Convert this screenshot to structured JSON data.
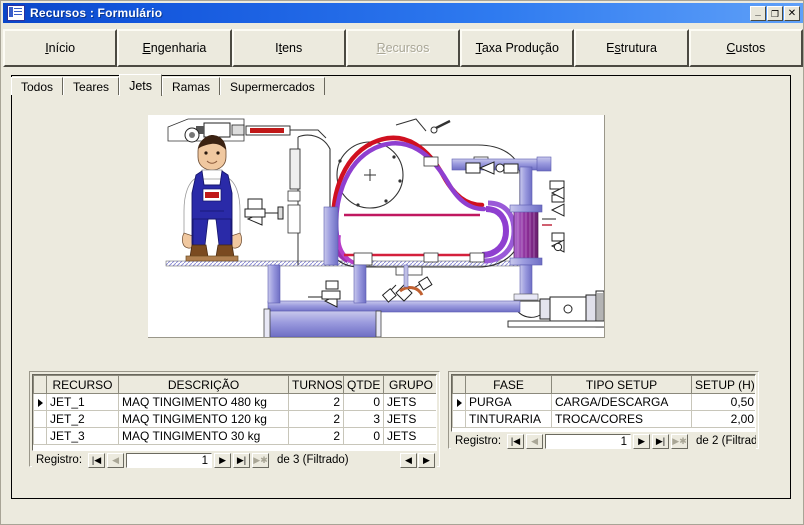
{
  "window": {
    "title": "Recursos : Formulário",
    "icon": "access-form-icon",
    "minimize_label": "_",
    "maximize_label": "❐",
    "close_label": "✕"
  },
  "menubar": {
    "items": [
      {
        "label": "Início",
        "accel": "I",
        "disabled": false,
        "name": "menu-inicio"
      },
      {
        "label": "Engenharia",
        "accel": "E",
        "disabled": false,
        "name": "menu-engenharia"
      },
      {
        "label": "Itens",
        "accel": "t",
        "disabled": false,
        "name": "menu-itens"
      },
      {
        "label": "Recursos",
        "accel": "R",
        "disabled": true,
        "name": "menu-recursos"
      },
      {
        "label": "Taxa Produção",
        "accel": "T",
        "disabled": false,
        "name": "menu-taxa-producao"
      },
      {
        "label": "Estrutura",
        "accel": "s",
        "disabled": false,
        "name": "menu-estrutura"
      },
      {
        "label": "Custos",
        "accel": "C",
        "disabled": false,
        "name": "menu-custos"
      }
    ]
  },
  "tabs": {
    "active": "Jets",
    "items": [
      {
        "label": "Todos",
        "active": false
      },
      {
        "label": "Teares",
        "active": false
      },
      {
        "label": "Jets",
        "active": true
      },
      {
        "label": "Ramas",
        "active": false
      },
      {
        "label": "Supermercados",
        "active": false
      }
    ]
  },
  "picture": {
    "name": "jet-dyeing-machine-diagram",
    "alt": "Diagrama de máquina de tingimento jet com operador, tubulação, trocador de calor e bomba"
  },
  "resources_grid": {
    "columns": [
      "RECURSO",
      "DESCRIÇÃO",
      "TURNOS",
      "QTDE",
      "GRUPO"
    ],
    "rows": [
      {
        "selected": true,
        "RECURSO": "JET_1",
        "DESCRIÇÃO": "MAQ TINGIMENTO 480 kg",
        "TURNOS": "2",
        "QTDE": "0",
        "GRUPO": "JETS"
      },
      {
        "selected": false,
        "RECURSO": "JET_2",
        "DESCRIÇÃO": "MAQ TINGIMENTO 120 kg",
        "TURNOS": "2",
        "QTDE": "3",
        "GRUPO": "JETS"
      },
      {
        "selected": false,
        "RECURSO": "JET_3",
        "DESCRIÇÃO": "MAQ TINGIMENTO 30 kg",
        "TURNOS": "2",
        "QTDE": "0",
        "GRUPO": "JETS"
      }
    ],
    "nav": {
      "label": "Registro:",
      "current": "1",
      "status": "de  3 (Filtrado)",
      "first_glyph": "|◀",
      "prev_glyph": "◀",
      "next_glyph": "▶",
      "last_glyph": "▶|",
      "new_glyph": "▶✱",
      "scroll_left_glyph": "◀",
      "scroll_right_glyph": "▶"
    }
  },
  "setup_grid": {
    "columns": [
      "FASE",
      "TIPO SETUP",
      "SETUP (H)"
    ],
    "rows": [
      {
        "selected": true,
        "FASE": "PURGA",
        "TIPO SETUP": "CARGA/DESCARGA",
        "SETUP (H)": "0,50"
      },
      {
        "selected": false,
        "FASE": "TINTURARIA",
        "TIPO SETUP": "TROCA/CORES",
        "SETUP (H)": "2,00"
      }
    ],
    "nav": {
      "label": "Registro:",
      "current": "1",
      "status": "de  2 (Filtrado",
      "first_glyph": "|◀",
      "prev_glyph": "◀",
      "next_glyph": "▶",
      "last_glyph": "▶|",
      "new_glyph": "▶✱"
    }
  },
  "colors": {
    "title_start": "#0a46c8",
    "title_end": "#5fa0f8",
    "face": "#eceade",
    "grid_line": "#c8c6ba",
    "header_line": "#8b897c",
    "disabled_text": "#a9a696",
    "pipe_blue": "#8f8fd8",
    "coil_magenta": "#cc1f8f",
    "coil_red": "#e0202a",
    "overalls_blue": "#2a2aa8"
  }
}
